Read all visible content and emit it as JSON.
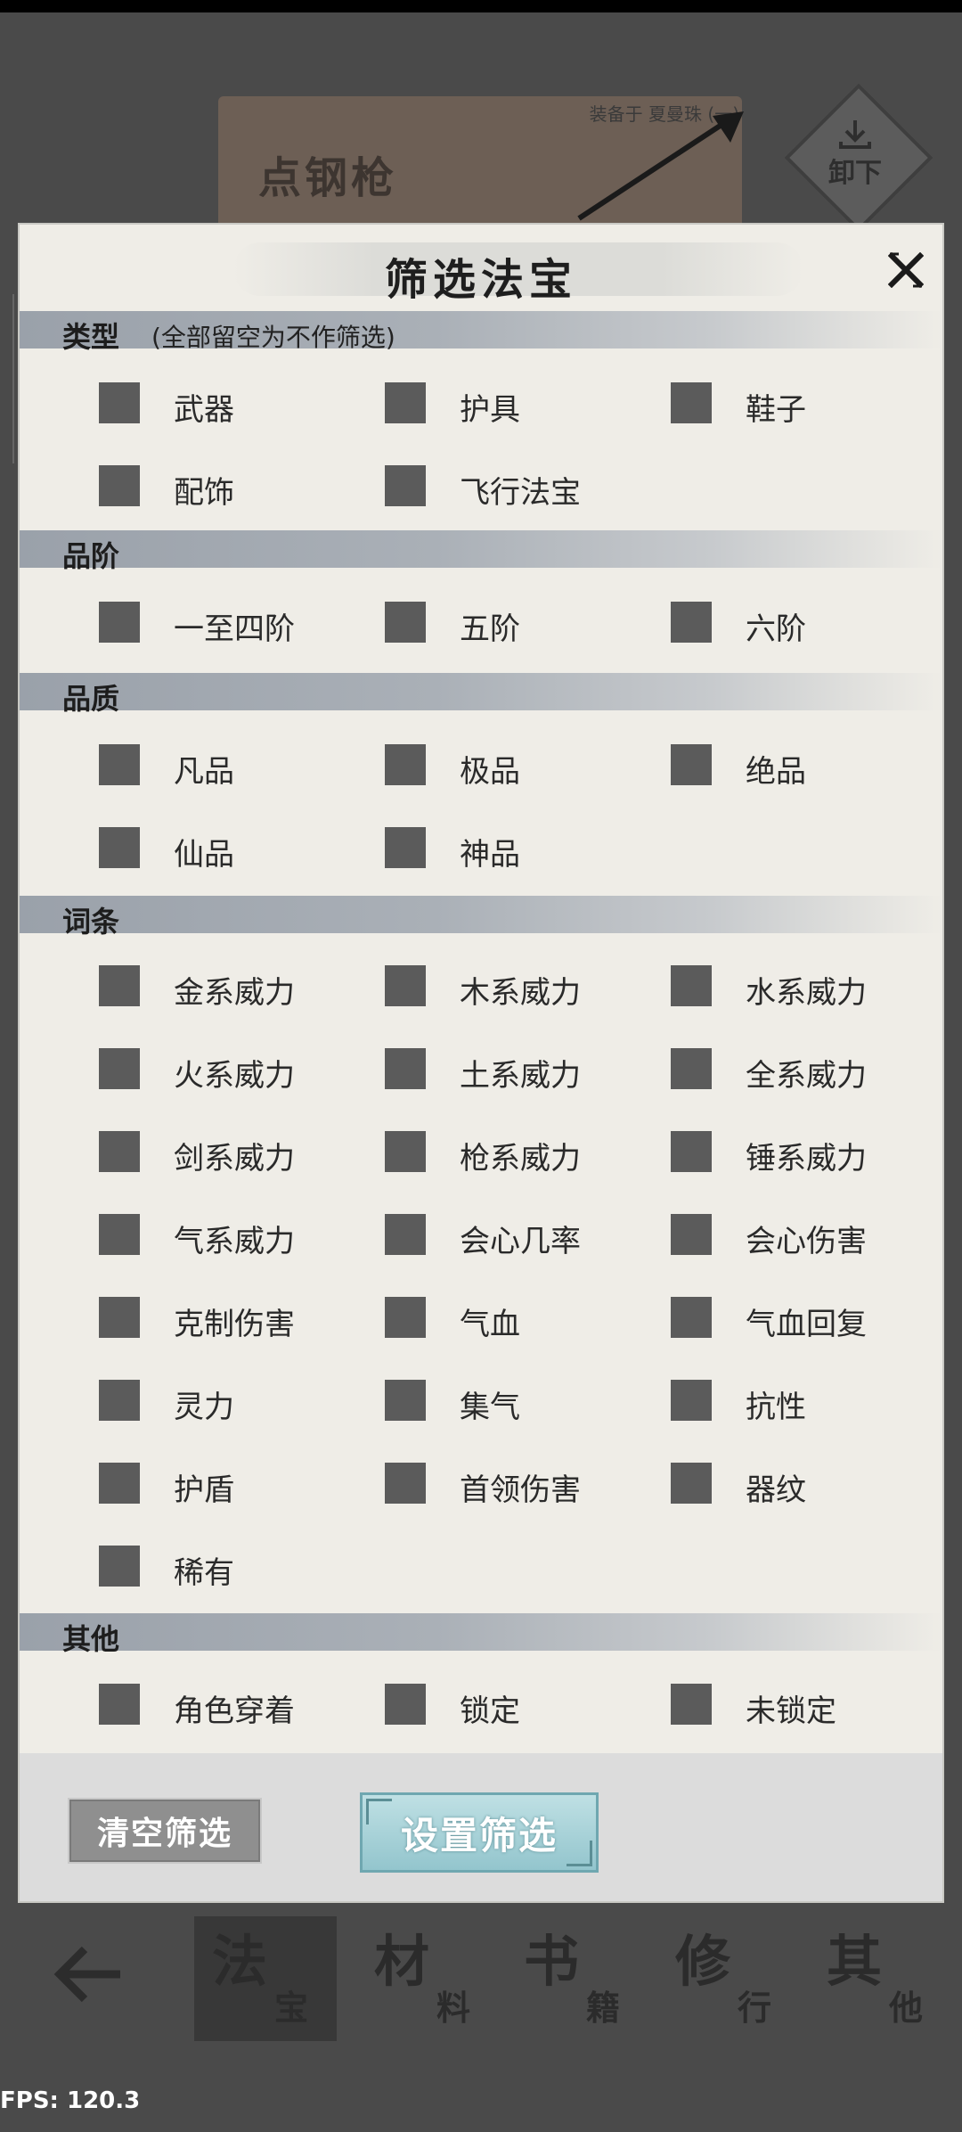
{
  "background": {
    "equipped_text": "装备于 夏曼珠 (一)",
    "item_name": "点钢枪",
    "unequip_label": "卸下"
  },
  "modal": {
    "title": "筛选法宝",
    "sections": {
      "type": {
        "title": "类型",
        "hint": "(全部留空为不作筛选)",
        "options": [
          "武器",
          "护具",
          "鞋子",
          "配饰",
          "飞行法宝"
        ]
      },
      "tier": {
        "title": "品阶",
        "options": [
          "一至四阶",
          "五阶",
          "六阶"
        ]
      },
      "quality": {
        "title": "品质",
        "options": [
          "凡品",
          "极品",
          "绝品",
          "仙品",
          "神品"
        ]
      },
      "affix": {
        "title": "词条",
        "options": [
          "金系威力",
          "木系威力",
          "水系威力",
          "火系威力",
          "土系威力",
          "全系威力",
          "剑系威力",
          "枪系威力",
          "锤系威力",
          "气系威力",
          "会心几率",
          "会心伤害",
          "克制伤害",
          "气血",
          "气血回复",
          "灵力",
          "集气",
          "抗性",
          "护盾",
          "首领伤害",
          "器纹",
          "稀有"
        ]
      },
      "other": {
        "title": "其他",
        "options": [
          "角色穿着",
          "锁定",
          "未锁定"
        ]
      }
    },
    "buttons": {
      "clear": "清空筛选",
      "apply": "设置筛选"
    }
  },
  "bottom_nav": {
    "tabs": [
      {
        "big": "法",
        "small": "宝"
      },
      {
        "big": "材",
        "small": "料"
      },
      {
        "big": "书",
        "small": "籍"
      },
      {
        "big": "修",
        "small": "行"
      },
      {
        "big": "其",
        "small": "他"
      }
    ]
  },
  "fps": "FPS: 120.3"
}
